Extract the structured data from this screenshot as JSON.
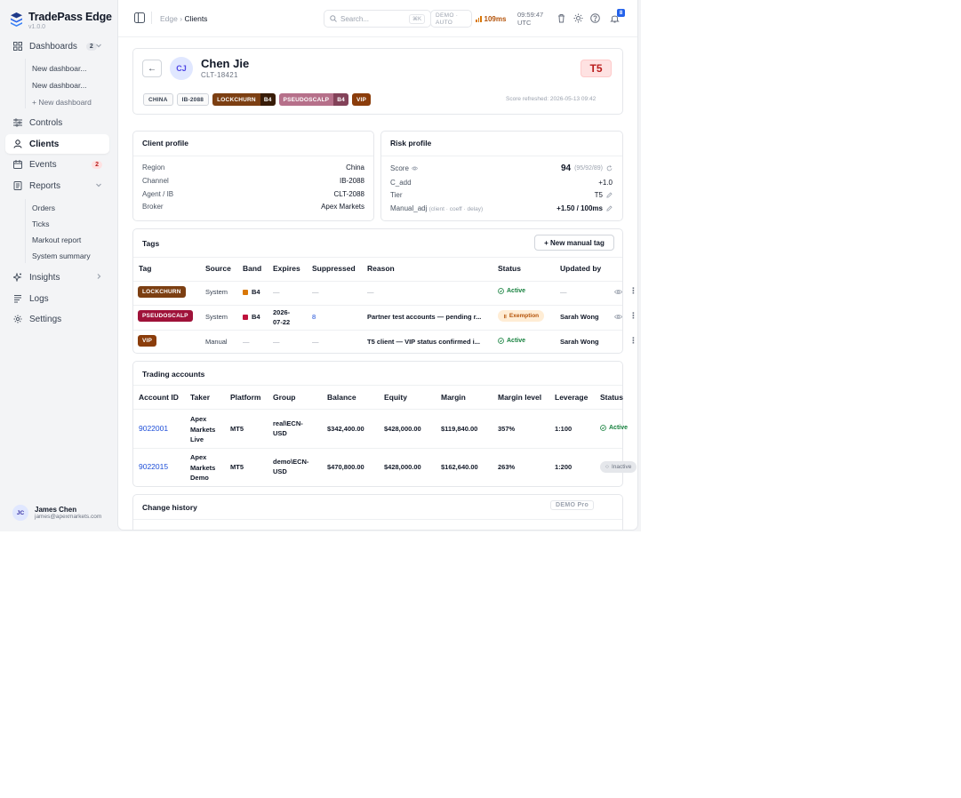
{
  "app": {
    "name": "TradePass Edge",
    "version": "v1.0.0"
  },
  "sidebar": {
    "dashboards": {
      "label": "Dashboards",
      "count": "2"
    },
    "dashboard_items": [
      "New dashboar...",
      "New dashboar..."
    ],
    "new_dashboard": "+ New dashboard",
    "controls": "Controls",
    "clients": "Clients",
    "events": {
      "label": "Events",
      "count": "2"
    },
    "reports": "Reports",
    "report_items": [
      "Orders",
      "Ticks",
      "Markout report",
      "System summary"
    ],
    "insights": "Insights",
    "logs": "Logs",
    "settings": "Settings"
  },
  "user": {
    "initials": "JC",
    "name": "James Chen",
    "email": "james@apexmarkets.com"
  },
  "topbar": {
    "breadcrumb_root": "Edge",
    "breadcrumb_sep": "›",
    "breadcrumb_current": "Clients",
    "search_placeholder": "Search...",
    "search_shortcut": "⌘K",
    "mode_line1": "DEMO ·",
    "mode_line2": "AUTO",
    "latency": "109ms",
    "time_line1": "09:59:47",
    "time_line2": "UTC",
    "notifications": "8"
  },
  "client": {
    "back": "←",
    "initials": "CJ",
    "name": "Chen Jie",
    "id": "CLT-18421",
    "tier": "T5",
    "chips": {
      "region": "CHINA",
      "ib": "IB-2088",
      "lockchurn": "LOCKCHURN",
      "lockchurn_band": "B4",
      "pseudoscalp": "PSEUDOSCALP",
      "pseudoscalp_band": "B4",
      "vip": "VIP"
    },
    "score_refreshed": "Score refreshed: 2026-05-13 09:42"
  },
  "client_profile": {
    "title": "Client profile",
    "rows": [
      {
        "label": "Region",
        "value": "China"
      },
      {
        "label": "Channel",
        "value": "IB-2088"
      },
      {
        "label": "Agent / IB",
        "value": "CLT-2088"
      },
      {
        "label": "Broker",
        "value": "Apex Markets"
      }
    ]
  },
  "risk_profile": {
    "title": "Risk profile",
    "score_label": "Score",
    "score_value": "94",
    "score_detail": "(95/92/89)",
    "cadd_label": "C_add",
    "cadd_value": "+1.0",
    "tier_label": "Tier",
    "tier_value": "T5",
    "manual_label": "Manual_adj",
    "manual_hint": "(client · coeff · delay)",
    "manual_value": "+1.50 / 100ms"
  },
  "tags": {
    "title": "Tags",
    "new_button": "+ New manual tag",
    "headers": [
      "Tag",
      "Source",
      "Band",
      "Expires",
      "Suppressed",
      "Reason",
      "Status",
      "Updated by"
    ],
    "rows": [
      {
        "tag": "LOCKCHURN",
        "source": "System",
        "band": "B4",
        "expires": "—",
        "suppressed": "—",
        "reason": "—",
        "status": "Active",
        "updated_by": "—"
      },
      {
        "tag": "PSEUDOSCALP",
        "source": "System",
        "band": "B4",
        "expires_line1": "2026-",
        "expires_line2": "07-22",
        "suppressed": "8",
        "reason": "Partner test accounts — pending r...",
        "status": "Exemption",
        "updated_by": "Sarah Wong"
      },
      {
        "tag": "VIP",
        "source": "Manual",
        "band": "—",
        "expires": "—",
        "suppressed": "—",
        "reason": "T5 client — VIP status confirmed i...",
        "status": "Active",
        "updated_by": "Sarah Wong"
      }
    ]
  },
  "accounts": {
    "title": "Trading accounts",
    "headers": [
      "Account ID",
      "Taker",
      "Platform",
      "Group",
      "Balance",
      "Equity",
      "Margin",
      "Margin level",
      "Leverage",
      "Status"
    ],
    "rows": [
      {
        "id": "9022001",
        "taker": [
          "Apex",
          "Markets",
          "Live"
        ],
        "platform": "MT5",
        "group": [
          "real\\ECN-",
          "USD"
        ],
        "balance": "$342,400.00",
        "equity": "$428,000.00",
        "margin": "$119,840.00",
        "margin_level": "357%",
        "leverage": "1:100",
        "status": "Active"
      },
      {
        "id": "9022015",
        "taker": [
          "Apex",
          "Markets",
          "Demo"
        ],
        "platform": "MT5",
        "group": [
          "demo\\ECN-",
          "USD"
        ],
        "balance": "$470,800.00",
        "equity": "$428,000.00",
        "margin": "$162,640.00",
        "margin_level": "263%",
        "leverage": "1:200",
        "status": "Inactive"
      }
    ]
  },
  "change_history": {
    "title": "Change history",
    "badge": "DEMO Pro"
  },
  "colors": {
    "accent": "#1d4ed8",
    "lockchurn": "#7c3f12",
    "pseudoscalp_tag": "#9f1239",
    "vip": "#8b3d0b",
    "tier_bg": "#fee2e2",
    "active": "#15803d",
    "exemption": "#b45309"
  },
  "icons": [
    "layers-logo-icon",
    "grid-icon",
    "sliders-icon",
    "user-icon",
    "calendar-icon",
    "report-icon",
    "sparkle-icon",
    "logs-icon",
    "gear-icon",
    "panel-icon",
    "search-icon",
    "signal-icon",
    "trash-icon",
    "sun-icon",
    "help-icon",
    "bell-icon",
    "eye-icon",
    "refresh-icon",
    "pencil-icon",
    "check-circle-icon",
    "more-icon"
  ]
}
